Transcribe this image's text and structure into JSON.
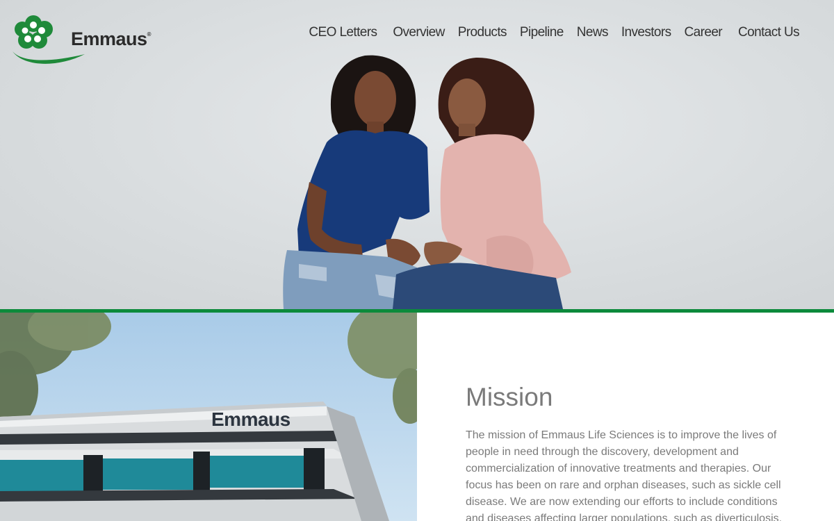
{
  "brand": {
    "name": "Emmaus",
    "registered_mark": "®",
    "logo_green": "#1f8a3a"
  },
  "nav": {
    "items": [
      {
        "label": "CEO Letters"
      },
      {
        "label": "Overview"
      },
      {
        "label": "Products"
      },
      {
        "label": "Pipeline"
      },
      {
        "label": "News"
      },
      {
        "label": "Investors"
      },
      {
        "label": "Career"
      },
      {
        "label": "Contact Us"
      }
    ],
    "text_color": "#333333"
  },
  "hero": {
    "image": "two-women-seated-portrait",
    "background": "#dcdfe1"
  },
  "divider_color": "#0c8a3b",
  "building": {
    "image": "emmaus-headquarters-building",
    "sign_text": "Emmaus"
  },
  "mission": {
    "title": "Mission",
    "body": "The mission of Emmaus Life Sciences is to improve the lives of people in need through the discovery, development and commercialization of innovative treatments and therapies. Our focus has been on rare and orphan diseases, such as sickle cell disease. We are now extending our efforts to include conditions and diseases affecting larger populations, such as diverticulosis.",
    "text_color": "#7a7a7a"
  }
}
